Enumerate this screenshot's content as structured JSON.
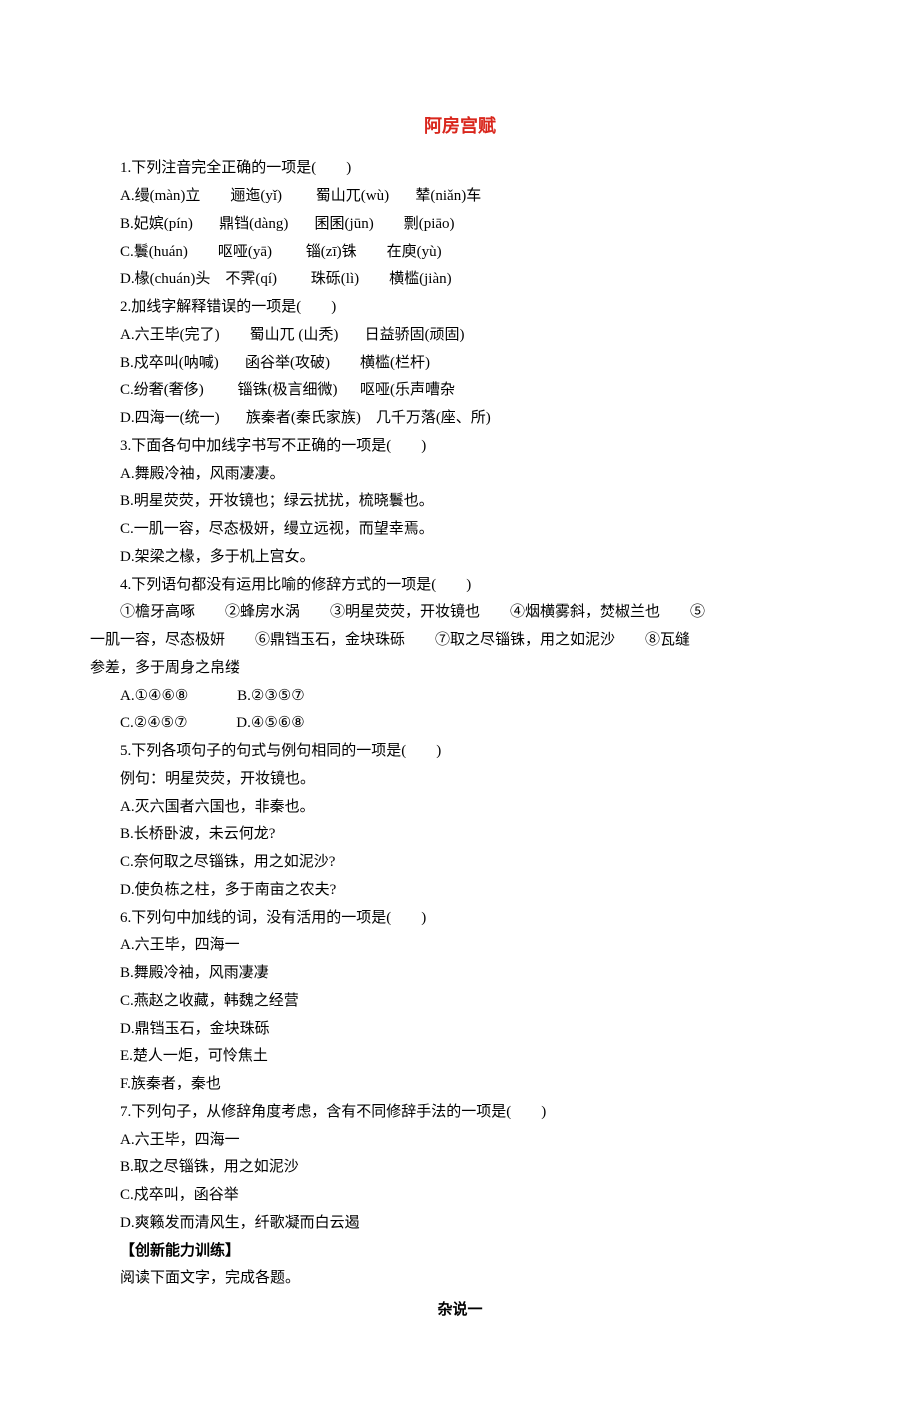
{
  "title": "阿房宫赋",
  "q1": {
    "stem": "1.下列注音完全正确的一项是(　　)",
    "opts": [
      "A.缦(màn)立        逦迤(yǐ)         蜀山兀(wù)       辇(niǎn)车",
      "B.妃嫔(pín)       鼎铛(dàng)       囷囷(jūn)        剽(piāo)",
      "C.鬟(huán)        呕哑(yā)         锱(zī)铢        在庾(yù)",
      "D.椽(chuán)头    不霁(qí)         珠砾(lì)        横槛(jiàn)"
    ]
  },
  "q2": {
    "stem": "2.加线字解释错误的一项是(　　)",
    "opts": [
      "A.六王毕(完了)        蜀山兀 (山秃)       日益骄固(顽固)",
      "B.戍卒叫(呐喊)       函谷举(攻破)        横槛(栏杆)",
      "C.纷奢(奢侈)         锱铢(极言细微)      呕哑(乐声嘈杂",
      "D.四海一(统一)       族秦者(秦氏家族)    几千万落(座、所)"
    ]
  },
  "q3": {
    "stem": "3.下面各句中加线字书写不正确的一项是(　　)",
    "opts": [
      "A.舞殿冷袖，风雨凄凄。",
      "B.明星荧荧，开妆镜也；绿云扰扰，梳晓鬟也。",
      "C.一肌一容，尽态极妍，缦立远视，而望幸焉。",
      "D.架梁之椽，多于机上宫女。"
    ]
  },
  "q4": {
    "stem": "4.下列语句都没有运用比喻的修辞方式的一项是(　　)",
    "body_line1": "　　①檐牙高啄　　②蜂房水涡　　③明星荧荧，开妆镜也　　④烟横雾斜，焚椒兰也　　⑤",
    "body_line2": "一肌一容，尽态极妍　　⑥鼎铛玉石，金块珠砾　　⑦取之尽锱铢，用之如泥沙　　⑧瓦缝",
    "body_line3": "参差，多于周身之帛缕",
    "opts": [
      "A.①④⑥⑧             B.②③⑤⑦",
      "C.②④⑤⑦             D.④⑤⑥⑧"
    ]
  },
  "q5": {
    "stem": "5.下列各项句子的句式与例句相同的一项是(　　)",
    "example": "例句：明星荧荧，开妆镜也。",
    "opts": [
      "A.灭六国者六国也，非秦也。",
      "B.长桥卧波，未云何龙?",
      "C.奈何取之尽锱铢，用之如泥沙?",
      "D.使负栋之柱，多于南亩之农夫?"
    ]
  },
  "q6": {
    "stem": "6.下列句中加线的词，没有活用的一项是(　　)",
    "opts": [
      "A.六王毕，四海一",
      "B.舞殿冷袖，风雨凄凄",
      "C.燕赵之收藏，韩魏之经营",
      "D.鼎铛玉石，金块珠砾",
      "E.楚人一炬，可怜焦土",
      "F.族秦者，秦也"
    ]
  },
  "q7": {
    "stem": "7.下列句子，从修辞角度考虑，含有不同修辞手法的一项是(　　)",
    "opts": [
      "A.六王毕，四海一",
      "B.取之尽锱铢，用之如泥沙",
      "C.戍卒叫，函谷举",
      "D.爽籁发而清风生，纤歌凝而白云遏"
    ]
  },
  "section": "【创新能力训练】",
  "reading_intro": "阅读下面文字，完成各题。",
  "reading_title": "杂说一"
}
